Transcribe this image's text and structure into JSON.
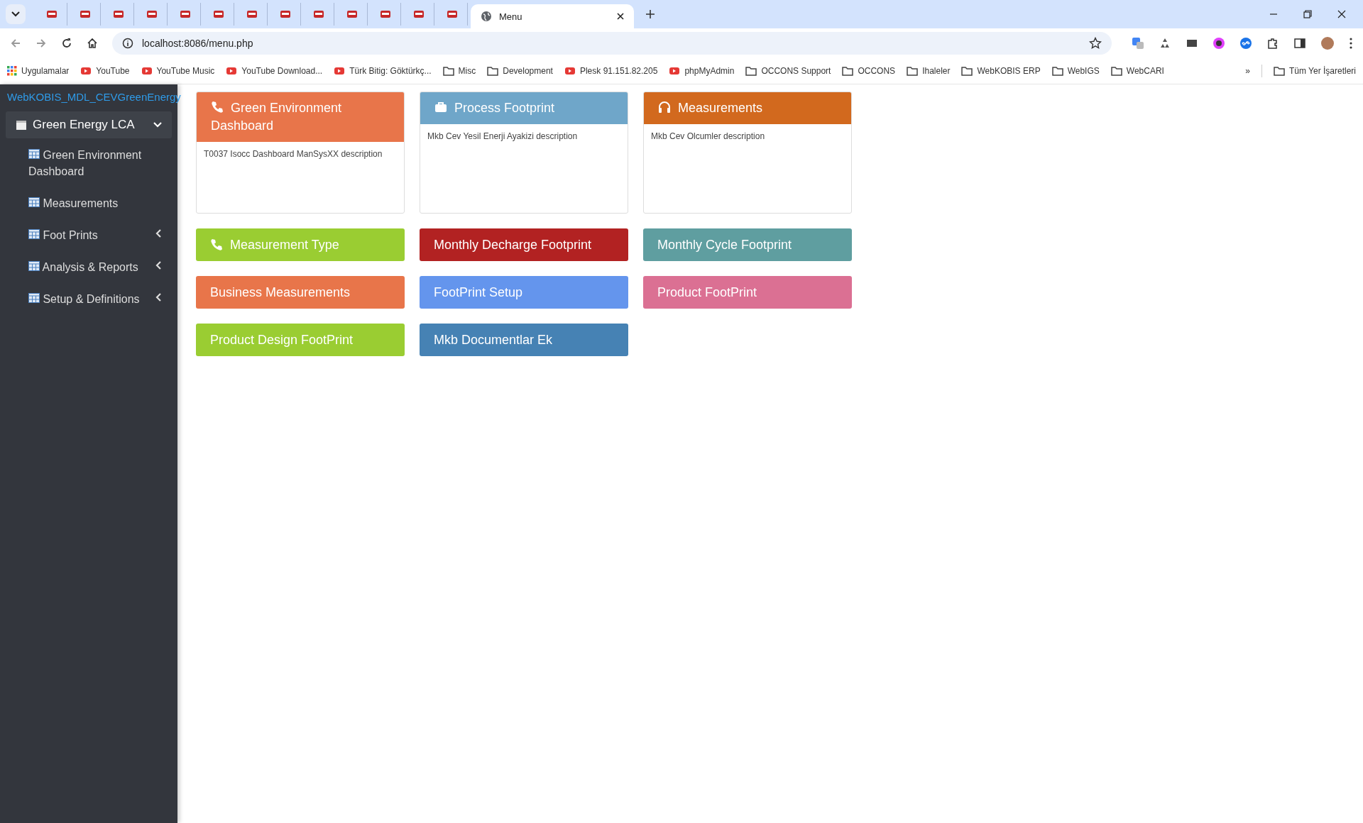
{
  "browser": {
    "tabs": [
      {
        "kind": "pinned",
        "selected": false
      },
      {
        "kind": "pinned",
        "selected": false
      },
      {
        "kind": "pinned",
        "selected": false
      },
      {
        "kind": "pinned",
        "selected": false
      },
      {
        "kind": "pinned",
        "selected": false
      },
      {
        "kind": "pinned",
        "selected": false
      },
      {
        "kind": "pinned",
        "selected": false
      },
      {
        "kind": "pinned",
        "selected": false
      },
      {
        "kind": "pinned",
        "selected": false
      },
      {
        "kind": "pinned",
        "selected": false
      },
      {
        "kind": "pinned",
        "selected": false
      },
      {
        "kind": "pinned",
        "selected": false
      },
      {
        "kind": "pinned",
        "selected": false
      },
      {
        "kind": "page",
        "title": "Menu",
        "selected": true
      }
    ],
    "address": "localhost:8086/menu.php",
    "bookmarks": [
      {
        "kind": "apps",
        "label": "Uygulamalar"
      },
      {
        "kind": "link",
        "label": "YouTube"
      },
      {
        "kind": "link",
        "label": "YouTube Music"
      },
      {
        "kind": "link",
        "label": "YouTube Download..."
      },
      {
        "kind": "link",
        "label": "Türk Bitig: Göktürkç..."
      },
      {
        "kind": "folder",
        "label": "Misc"
      },
      {
        "kind": "folder",
        "label": "Development"
      },
      {
        "kind": "link",
        "label": "Plesk 91.151.82.205"
      },
      {
        "kind": "link",
        "label": "phpMyAdmin"
      },
      {
        "kind": "folder",
        "label": "OCCONS Support"
      },
      {
        "kind": "folder",
        "label": "OCCONS"
      },
      {
        "kind": "folder",
        "label": "Ihaleler"
      },
      {
        "kind": "folder",
        "label": "WebKOBIS ERP"
      },
      {
        "kind": "folder",
        "label": "WebIGS"
      },
      {
        "kind": "folder",
        "label": "WebCARI"
      }
    ],
    "more": "»",
    "all_bookmarks": "Tüm Yer İşaretleri"
  },
  "sidebar": {
    "brand": "WebKOBIS_MDL_CEVGreenEnergy",
    "group": {
      "label": "Green Energy LCA",
      "expanded": true
    },
    "items": [
      {
        "label": "Green Environment Dashboard",
        "submenu": false
      },
      {
        "label": "Measurements",
        "submenu": false
      },
      {
        "label": "Foot Prints",
        "submenu": true
      },
      {
        "label": "Analysis & Reports",
        "submenu": true
      },
      {
        "label": "Setup & Definitions",
        "submenu": true
      }
    ]
  },
  "cards": [
    {
      "kind": "card",
      "title": "Green Environment Dashboard",
      "description": "T0037 Isocc Dashboard ManSysXX description",
      "color": "#e8754a"
    },
    {
      "kind": "card",
      "title": "Process Footprint",
      "description": "Mkb Cev Yesil Enerji Ayakizi description",
      "color": "#6fa6c9"
    },
    {
      "kind": "card",
      "title": "Measurements",
      "description": "Mkb Cev Olcumler description",
      "color": "#d2691e"
    },
    {
      "kind": "tile",
      "title": "Measurement Type",
      "color": "#9acd32"
    },
    {
      "kind": "tile",
      "title": "Monthly Decharge Footprint",
      "color": "#b22222"
    },
    {
      "kind": "tile",
      "title": "Monthly Cycle Footprint",
      "color": "#5f9ea0"
    },
    {
      "kind": "tile",
      "title": "Business Measurements",
      "color": "#e8754a"
    },
    {
      "kind": "tile",
      "title": "FootPrint Setup",
      "color": "#6495ed"
    },
    {
      "kind": "tile",
      "title": "Product FootPrint",
      "color": "#db7093"
    },
    {
      "kind": "tile",
      "title": "Product Design FootPrint",
      "color": "#9acd32"
    },
    {
      "kind": "tile",
      "title": "Mkb Documentlar Ek",
      "color": "#4682b4"
    }
  ]
}
